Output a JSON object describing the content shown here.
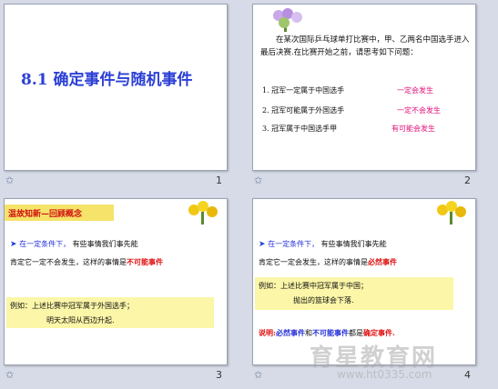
{
  "slides": [
    {
      "number": "1",
      "title": "8.1  确定事件与随机事件"
    },
    {
      "number": "2",
      "intro": "在某次国际乒乓球单打比赛中，甲、乙两名中国选手进入最后决赛.在比赛开始之前，请思考如下问题：",
      "questions": [
        {
          "text": "1. 冠军一定属于中国选手",
          "answer": "一定会发生"
        },
        {
          "text": "2. 冠军可能属于外国选手",
          "answer": "一定不会发生"
        },
        {
          "text": "3. 冠军属于中国选手甲",
          "answer": "有可能会发生"
        }
      ]
    },
    {
      "number": "3",
      "header": "温故知新—回顾概念",
      "line1": "在一定条件下，",
      "line1b": "有些事情我们事先能",
      "line2a": "肯定它一定不会发生，这样的事情是",
      "line2b": "不可能事件",
      "ex1": "例如：上述比赛中冠军属于外国选手；",
      "ex2": "明天太阳从西边升起."
    },
    {
      "number": "4",
      "line1": "在一定条件下，",
      "line1b": "有些事情我们事先能",
      "line2a": "肯定它一定会发生，这样的事情是",
      "line2b": "必然事件",
      "ex1": "例如：上述比赛中冠军属于中国；",
      "ex2": "抛出的篮球会下落.",
      "note_label": "说明",
      "note_a": "必然事件",
      "note_b": "和",
      "note_c": "不可能事件",
      "note_d": "都是",
      "note_e": "确定事件."
    }
  ],
  "footer_icon": "slide-star-icon",
  "watermark": "育星教育网",
  "watermark_url": "www.ht0335.com"
}
